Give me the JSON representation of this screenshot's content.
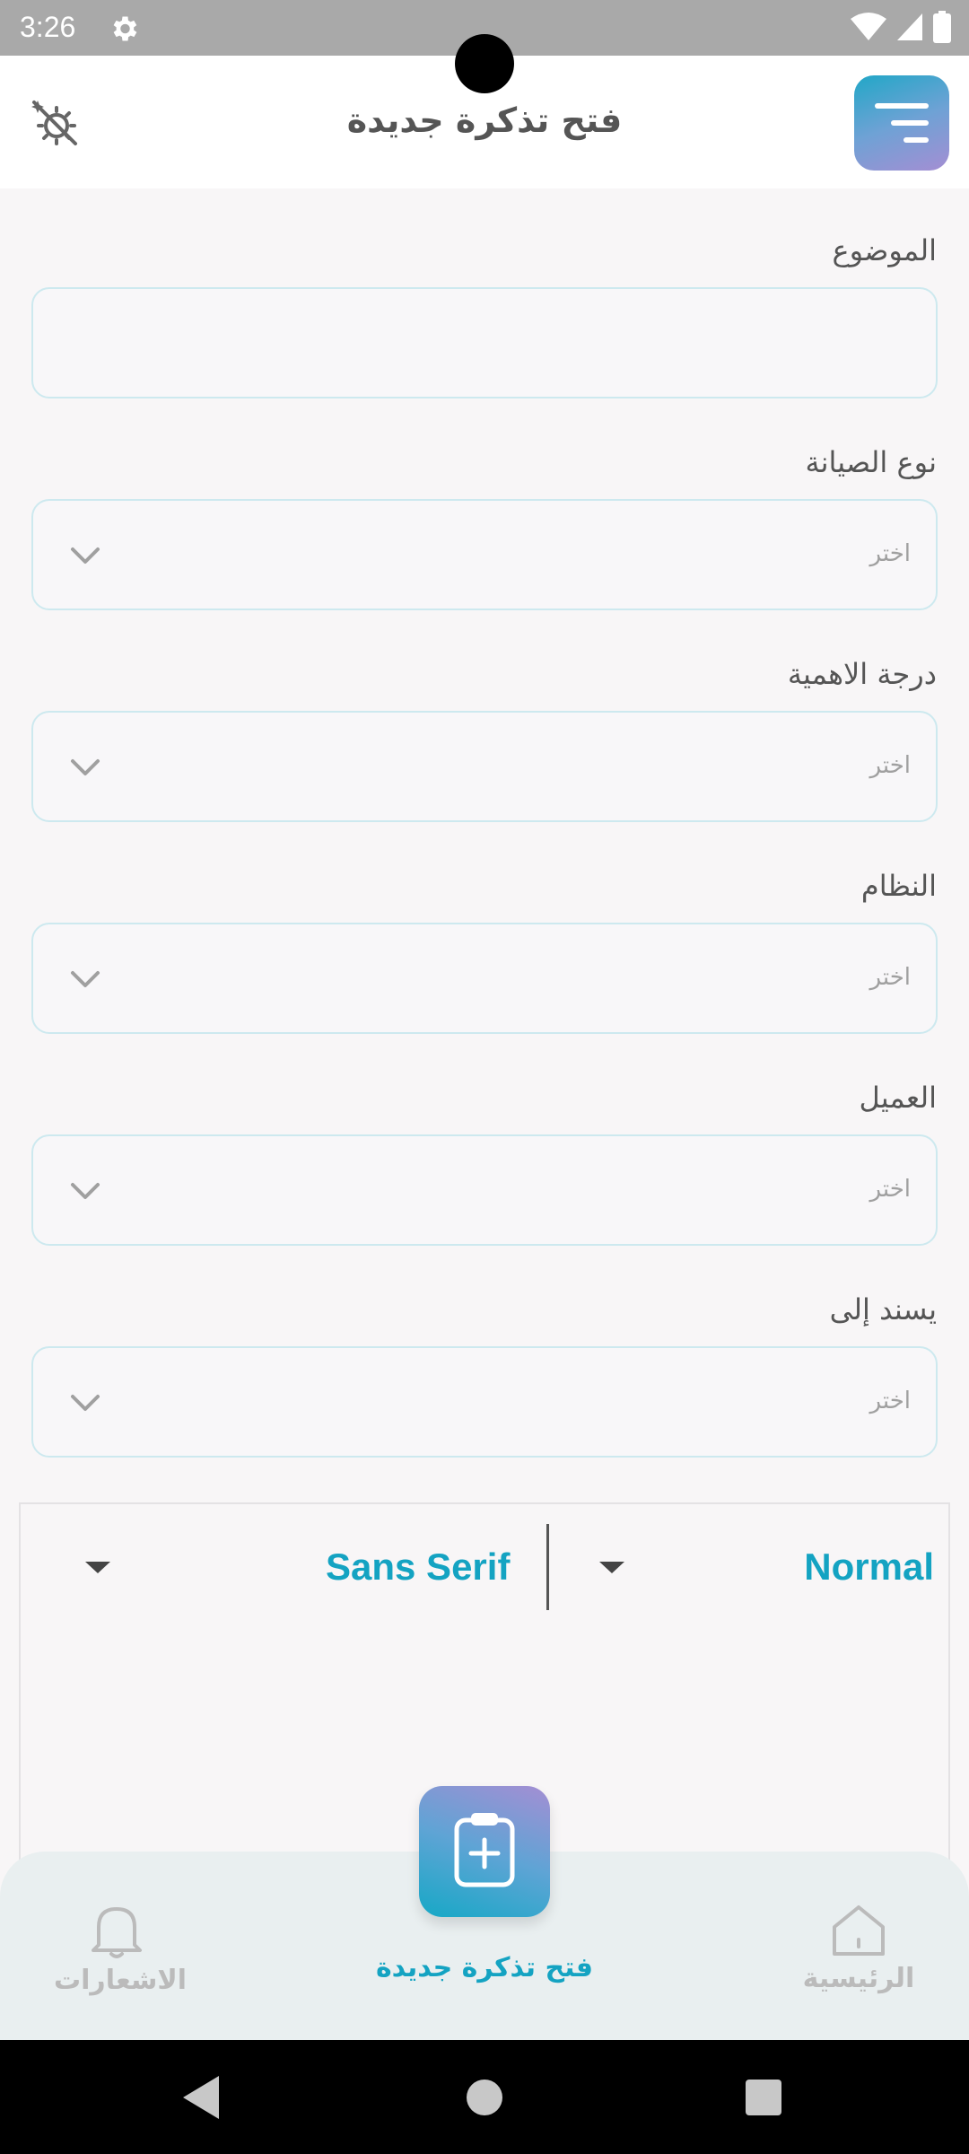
{
  "status_bar": {
    "time": "3:26",
    "icons": [
      "gear-icon",
      "wifi-icon",
      "signal-icon",
      "battery-icon"
    ]
  },
  "header": {
    "title": "فتح تذكرة جديدة",
    "menu_icon": "menu-lines-icon",
    "theme_icon": "theme-toggle-icon",
    "accent_gradient": [
      "#21a7c7",
      "#a48ed3"
    ]
  },
  "form": {
    "subject": {
      "label": "الموضوع",
      "value": ""
    },
    "fields": [
      {
        "label": "نوع الصيانة",
        "placeholder": "اختر"
      },
      {
        "label": "درجة الاهمية",
        "placeholder": "اختر"
      },
      {
        "label": "النظام",
        "placeholder": "اختر"
      },
      {
        "label": "العميل",
        "placeholder": "اختر"
      },
      {
        "label": "يسند إلى",
        "placeholder": "اختر"
      }
    ]
  },
  "editor": {
    "paragraph_style": "Normal",
    "font_family": "Sans Serif"
  },
  "bottom_nav": {
    "home": {
      "label": "الرئيسية",
      "icon": "home-icon"
    },
    "new_ticket": {
      "label": "فتح تذكرة جديدة",
      "icon": "clipboard-plus-icon"
    },
    "notifications": {
      "label": "الاشعارات",
      "icon": "bell-icon"
    }
  },
  "colors": {
    "accent": "#14a3c2",
    "field_border": "#cde9ef",
    "background": "#f8f6f7"
  }
}
